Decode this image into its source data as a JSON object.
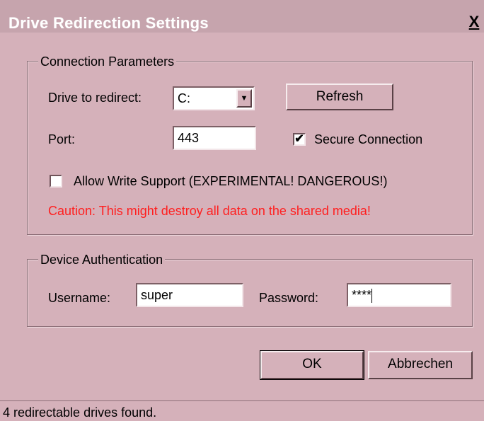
{
  "window": {
    "title": "Drive Redirection Settings",
    "close_glyph": "X"
  },
  "connection": {
    "legend": "Connection Parameters",
    "drive_label": "Drive to redirect:",
    "drive_value": "C:",
    "refresh_label": "Refresh",
    "port_label": "Port:",
    "port_value": "443",
    "secure_label": "Secure Connection",
    "secure_checked": true,
    "write_label": "Allow Write Support (EXPERIMENTAL! DANGEROUS!)",
    "write_checked": false,
    "caution_text": "Caution: This might destroy all data on the shared media!"
  },
  "auth": {
    "legend": "Device Authentication",
    "username_label": "Username:",
    "username_value": "super",
    "password_label": "Password:",
    "password_value": "****"
  },
  "buttons": {
    "ok_label": "OK",
    "cancel_label": "Abbrechen"
  },
  "status": {
    "text": "4 redirectable drives found."
  },
  "colors": {
    "caution": "#ff1f1f",
    "dialog_bg": "#d5b1ba"
  }
}
